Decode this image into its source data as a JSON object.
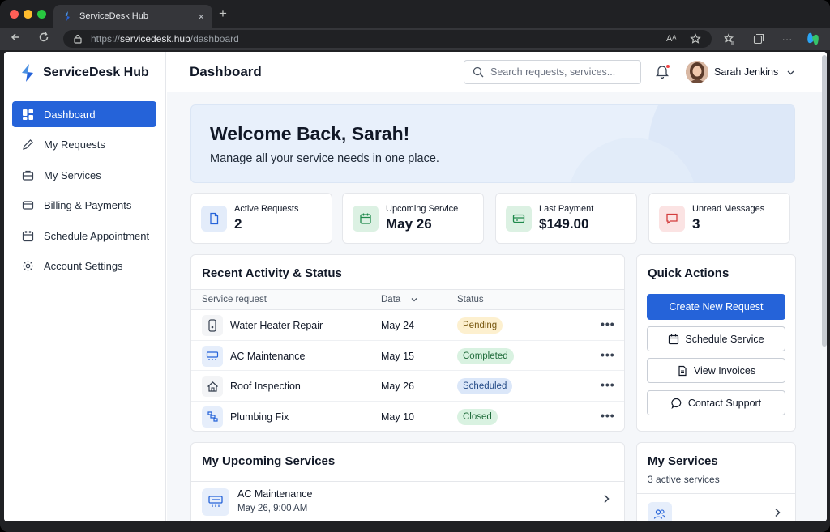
{
  "browser": {
    "tab_title": "ServiceDesk Hub",
    "tab_close": "×",
    "new_tab": "+",
    "url_prefix": "https://",
    "url_host": "servicedesk.hub",
    "url_path": "/dashboard"
  },
  "brand": {
    "name": "ServiceDesk Hub",
    "color": "#2563d9"
  },
  "sidebar": {
    "items": [
      {
        "label": "Dashboard",
        "icon": "dashboard-icon",
        "active": true
      },
      {
        "label": "My Requests",
        "icon": "pencil-icon"
      },
      {
        "label": "My Services",
        "icon": "briefcase-icon"
      },
      {
        "label": "Billing & Payments",
        "icon": "card-icon"
      },
      {
        "label": "Schedule Appointment",
        "icon": "calendar-icon"
      },
      {
        "label": "Account Settings",
        "icon": "gear-icon"
      }
    ]
  },
  "header": {
    "title": "Dashboard",
    "search_placeholder": "Search requests, services...",
    "user_name": "Sarah Jenkins"
  },
  "welcome": {
    "title": "Welcome Back, Sarah!",
    "subtitle": "Manage all your service needs in one place."
  },
  "stats": [
    {
      "label": "Active Requests",
      "value": "2",
      "icon": "document-icon",
      "color": "#e3ecfa"
    },
    {
      "label": "Upcoming Service",
      "value": "May 26",
      "icon": "calendar-icon",
      "color": "#dcf1e3"
    },
    {
      "label": "Last Payment",
      "value": "$149.00",
      "icon": "card-icon",
      "color": "#dcf1e3"
    },
    {
      "label": "Unread Messages",
      "value": "3",
      "icon": "message-icon",
      "color": "#fbe3e3"
    }
  ],
  "activity": {
    "title": "Recent Activity & Status",
    "columns": [
      "Service request",
      "Data",
      "Status"
    ],
    "rows": [
      {
        "name": "Water Heater Repair",
        "date": "May 24",
        "status": "Pending",
        "icon": "water-heater-icon"
      },
      {
        "name": "AC Maintenance",
        "date": "May 15",
        "status": "Completed",
        "icon": "ac-unit-icon"
      },
      {
        "name": "Roof Inspection",
        "date": "May 26",
        "status": "Scheduled",
        "icon": "house-icon"
      },
      {
        "name": "Plumbing Fix",
        "date": "May 10",
        "status": "Closed",
        "icon": "pipe-icon"
      }
    ],
    "more": "•••"
  },
  "quick_actions": {
    "title": "Quick Actions",
    "primary": "Create New Request",
    "buttons": [
      "Schedule Service",
      "View Invoices",
      "Contact Support"
    ]
  },
  "upcoming": {
    "title": "My Upcoming Services",
    "items": [
      {
        "name": "AC Maintenance",
        "time": "May 26, 9:00 AM"
      }
    ]
  },
  "my_services": {
    "title": "My Services",
    "subtitle": "3 active services"
  }
}
